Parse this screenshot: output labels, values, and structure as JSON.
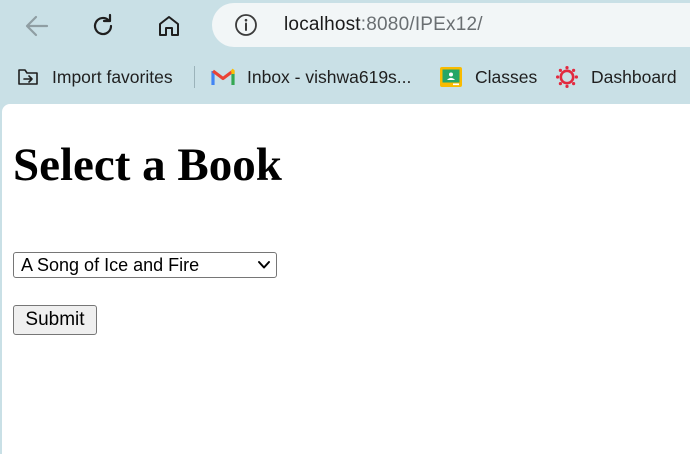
{
  "browser": {
    "url_host": "localhost",
    "url_rest": ":8080/IPEx12/",
    "bookmarks": [
      {
        "label": "Import favorites",
        "icon": "import-favorites-icon"
      },
      {
        "label": "Inbox  - vishwa619s...",
        "icon": "gmail-icon"
      },
      {
        "label": "Classes",
        "icon": "google-classroom-icon"
      },
      {
        "label": "Dashboard",
        "icon": "canvas-dashboard-icon"
      }
    ]
  },
  "page": {
    "heading": "Select a Book",
    "select": {
      "selected": "A Song of Ice and Fire"
    },
    "submit_label": "Submit"
  },
  "colors": {
    "chrome_bg": "#c9e0e6",
    "addressbar_bg": "#f2f6f7",
    "page_bg": "#ffffff"
  }
}
